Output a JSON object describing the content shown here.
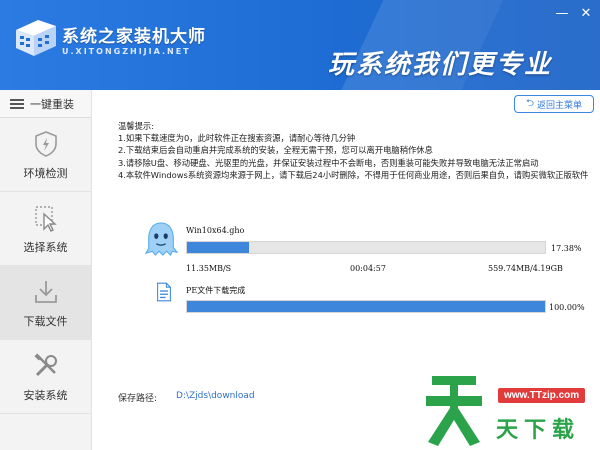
{
  "header": {
    "brand": "系统之家装机大师",
    "brand_url": "U.XITONGZHIJIA.NET",
    "slogan": "玩系统我们更专业",
    "minimize": "—",
    "close": "✕"
  },
  "sidebar": {
    "top_label": "一键重装",
    "items": [
      {
        "label": "环境检测",
        "icon": "shield-icon",
        "active": false
      },
      {
        "label": "选择系统",
        "icon": "cursor-icon",
        "active": false
      },
      {
        "label": "下载文件",
        "icon": "download-icon",
        "active": true
      },
      {
        "label": "安装系统",
        "icon": "tools-icon",
        "active": false
      }
    ]
  },
  "main": {
    "back_button": "返回主菜单",
    "tips_title": "温馨提示:",
    "tips": [
      "1.如果下载速度为0，此时软件正在搜索资源，请耐心等待几分钟",
      "2.下载结束后会自动重启并完成系统的安装，全程无需干预，您可以离开电脑稍作休息",
      "3.请移除U盘、移动硬盘、光驱里的光盘，并保证安装过程中不会断电，否则重装可能失败并导致电脑无法正常启动",
      "4.本软件Windows系统资源均来源于网上，请下载后24小时删除，不得用于任何商业用途，否则后果自负，请购买微软正版软件"
    ],
    "downloads": [
      {
        "name": "Win10x64.gho",
        "icon": "ghost-icon",
        "progress": 0.1738,
        "percent_text": "17.38%",
        "speed": "11.35MB/S",
        "time": "00:04:57",
        "size": "559.74MB/4.19GB"
      },
      {
        "name": "PE文件下载完成",
        "icon": "document-icon",
        "progress": 1.0,
        "percent_text": "100.00%"
      }
    ],
    "save_label": "保存路径:",
    "save_path": "D:\\Zjds\\download"
  },
  "watermark": {
    "url": "www.TTzip.com",
    "text": "天下载"
  },
  "colors": {
    "header_blue": "#1f6fd6",
    "progress_blue": "#3d86dc",
    "watermark_green": "#2aa34a",
    "watermark_red": "#e23b3b"
  }
}
